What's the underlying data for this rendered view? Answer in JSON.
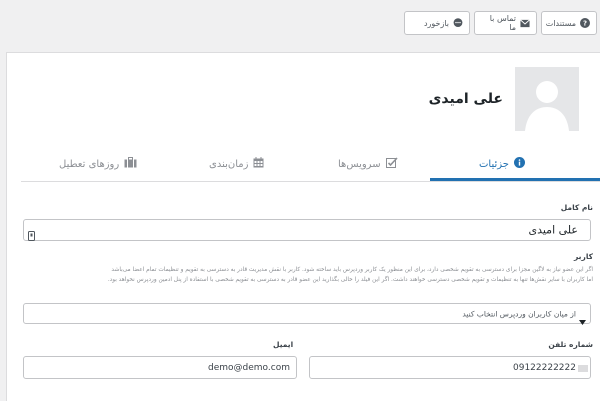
{
  "toolbar": {
    "docs_label": "مستندات",
    "contact_label": "تماس با ما",
    "feedback_label": "بازخورد"
  },
  "profile": {
    "name": "علی امیدی"
  },
  "tabs": [
    {
      "label": "جزئیات",
      "icon": "info-icon",
      "active": true
    },
    {
      "label": "سرویس‌ها",
      "icon": "checklist-icon",
      "active": false
    },
    {
      "label": "زمان‌بندی",
      "icon": "calendar-icon",
      "active": false
    },
    {
      "label": "روزهای تعطیل",
      "icon": "suitcase-icon",
      "active": false
    }
  ],
  "form": {
    "full_name_label": "نام کامل",
    "full_name_value": "علی امیدی",
    "user_label": "کاربر",
    "user_description_1": "اگر این عضو نیاز به لاگین مجزا برای دسترسی به تقویم شخصی دارد، برای این منظور یک کاربر وردپرس باید ساخته شود. کاربر با نقش مدیریت قادر به دسترسی به تقویم و تنظیمات تمام اعضا می‌باشد",
    "user_description_2": "اما کاربران با سایر نقش‌ها تنها به تنظیمات و تقویم شخصی دسترسی خواهند داشت. اگر این فیلد را خالی بگذارید این عضو قادر به دسترسی به تقویم شخصی با استفاده از پنل ادمین وردپرس نخواهد بود.",
    "user_select_value": "از میان کاربران وردپرس انتخاب کنید",
    "phone_label": "شماره تلفن",
    "phone_value": "09122222222",
    "email_label": "ایمیل",
    "email_value": "demo@demo.com"
  },
  "colors": {
    "accent": "#2271b1",
    "muted": "#8c8f94",
    "border": "#c3c4c7",
    "page_bg": "#f0f0f1"
  }
}
